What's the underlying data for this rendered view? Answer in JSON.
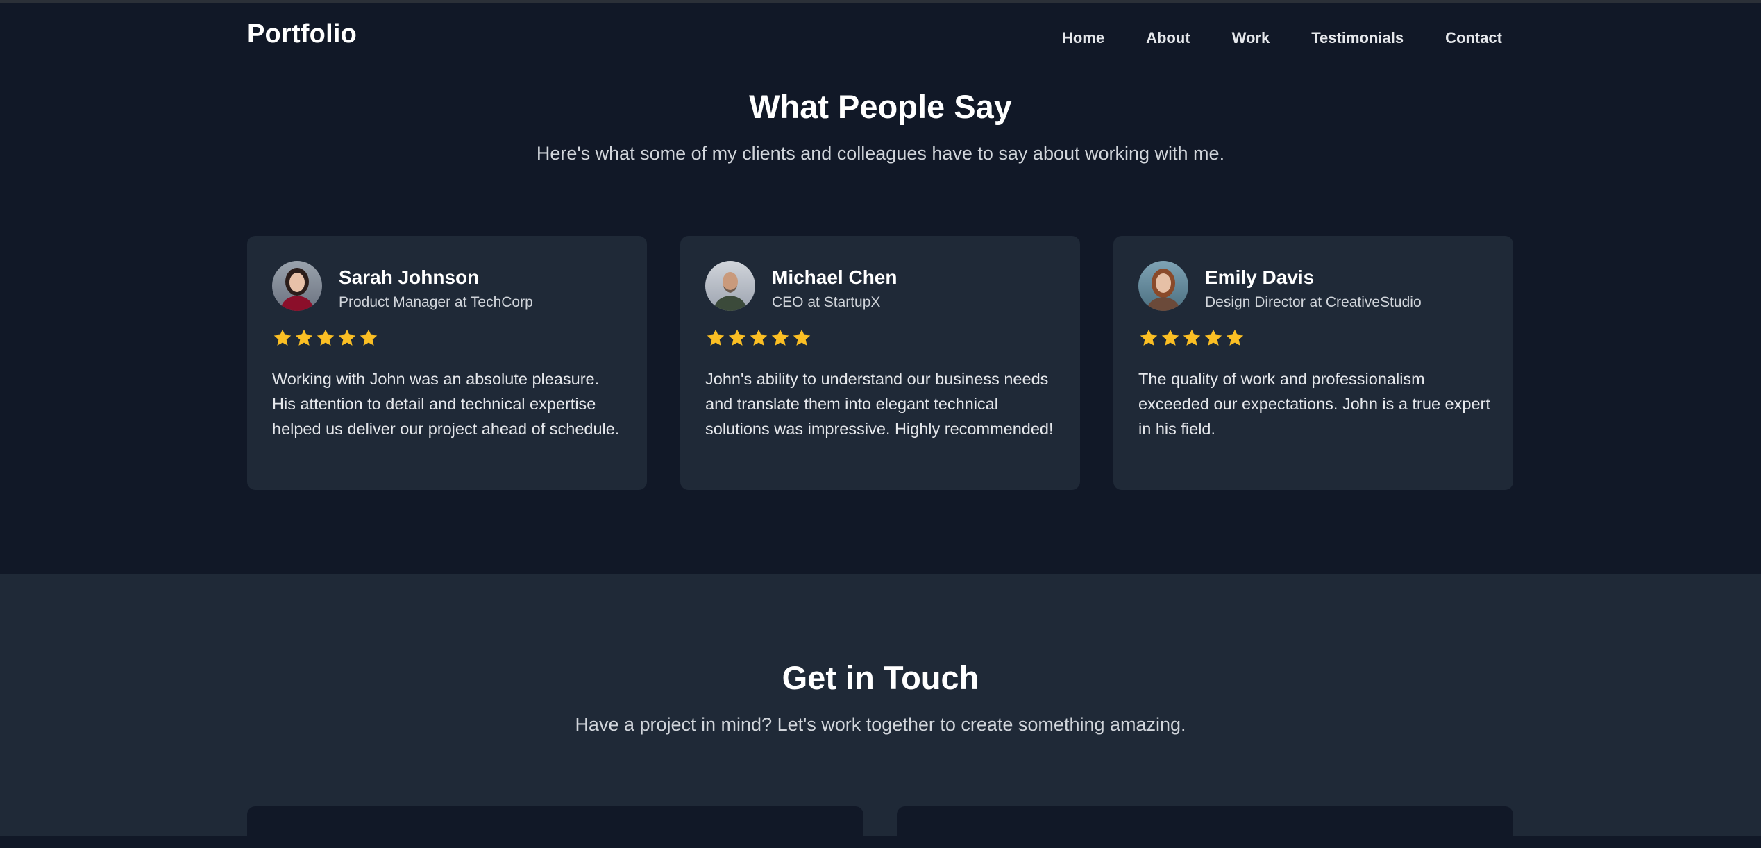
{
  "header": {
    "brand": "Portfolio",
    "nav": [
      "Home",
      "About",
      "Work",
      "Testimonials",
      "Contact"
    ]
  },
  "testimonials": {
    "title": "What People Say",
    "subtitle": "Here's what some of my clients and colleagues have to say about working with me.",
    "items": [
      {
        "name": "Sarah Johnson",
        "role": "Product Manager at TechCorp",
        "rating": 5,
        "quote": "Working with John was an absolute pleasure. His attention to detail and technical expertise helped us deliver our project ahead of schedule."
      },
      {
        "name": "Michael Chen",
        "role": "CEO at StartupX",
        "rating": 5,
        "quote": "John's ability to understand our business needs and translate them into elegant technical solutions was impressive. Highly recommended!"
      },
      {
        "name": "Emily Davis",
        "role": "Design Director at CreativeStudio",
        "rating": 5,
        "quote": "The quality of work and professionalism exceeded our expectations. John is a true expert in his field."
      }
    ]
  },
  "contact": {
    "title": "Get in Touch",
    "subtitle": "Have a project in mind? Let's work together to create something amazing."
  },
  "colors": {
    "background": "#111827",
    "card": "#1f2937",
    "star": "#fbbf24",
    "text_muted": "#d1d5db"
  },
  "icons": {
    "star": "star-icon"
  }
}
